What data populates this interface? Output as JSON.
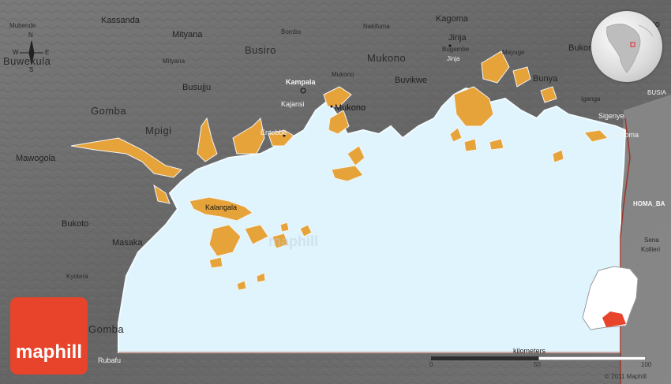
{
  "map": {
    "colors": {
      "land": "#6b6b6b",
      "lake": "#dff4fd",
      "islands": "#e6a33a",
      "kenya": "#8a8a8a",
      "border": "#9b3a2a",
      "logo": "#e8442b"
    },
    "place_labels": {
      "kassanda": "Kassanda",
      "mubende": "Mubende",
      "buwekula": "Buwekula",
      "mityana": "Mityana",
      "mityana_small": "Mityana",
      "busiro": "Busiro",
      "bombo": "Bombo",
      "nakifuma": "Nakifuma",
      "kagoma": "Kagoma",
      "jinja": "Jinja",
      "jinja_small": "Jinja",
      "bugembe": "Bugembe",
      "mayuge": "Mayuge",
      "bukoto_ne": "Bukor",
      "mukono": "Mukono",
      "mukono_small": "Mukono",
      "mukono_city": "Mukono",
      "buvikwe": "Buvikwe",
      "bunya": "Bunya",
      "busujju": "Busujju",
      "kampala": "Kampala",
      "kajansi": "Kajansi",
      "entebbe": "Entebbe",
      "gomba": "Gomba",
      "mpigi": "Mpigi",
      "mawogola": "Mawogola",
      "kalangala": "Kalangala",
      "bukoto": "Bukoto",
      "masaka": "Masaka",
      "kyotera": "Kyotera",
      "gomba_south": "Gomba",
      "rubafu": "Rubafu",
      "iganga": "Iganga",
      "sigenye": "Sigenye",
      "bukoma": "Bukoma",
      "busia": "BUSIA",
      "homa_bay": "HOMA_BA",
      "sena": "Sena",
      "kollieri": "Kollieri",
      "oro": "oro"
    },
    "compass": {
      "n": "N",
      "s": "S",
      "e": "E",
      "w": "W"
    },
    "scale": {
      "title": "kilometers",
      "ticks": [
        "0",
        "50",
        "100"
      ]
    },
    "watermark": "maphill",
    "logo_text": "maphill",
    "copyright": "© 2011 Maphill"
  }
}
